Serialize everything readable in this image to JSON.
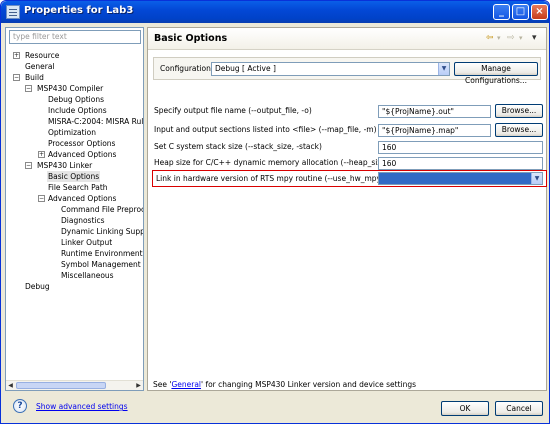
{
  "window": {
    "title": "Properties for Lab3",
    "min": "_",
    "max": "□",
    "close": "×"
  },
  "filter": {
    "placeholder": "type filter text"
  },
  "tree": [
    {
      "label": "Resource",
      "expander": "+"
    },
    {
      "label": "General"
    },
    {
      "label": "Build",
      "expander": "−"
    },
    {
      "label": "MSP430 Compiler",
      "expander": "−"
    },
    {
      "label": "Debug Options"
    },
    {
      "label": "Include Options"
    },
    {
      "label": "MISRA-C:2004: MISRA Rules"
    },
    {
      "label": "Optimization"
    },
    {
      "label": "Processor Options"
    },
    {
      "label": "Advanced Options",
      "expander": "+"
    },
    {
      "label": "MSP430 Linker",
      "expander": "−"
    },
    {
      "label": "Basic Options"
    },
    {
      "label": "File Search Path"
    },
    {
      "label": "Advanced Options",
      "expander": "−"
    },
    {
      "label": "Command File Preprocess"
    },
    {
      "label": "Diagnostics"
    },
    {
      "label": "Dynamic Linking Support"
    },
    {
      "label": "Linker Output"
    },
    {
      "label": "Runtime Environment"
    },
    {
      "label": "Symbol Management"
    },
    {
      "label": "Miscellaneous"
    },
    {
      "label": "Debug"
    }
  ],
  "page": {
    "title": "Basic Options",
    "nav_back": "⇦",
    "nav_fwd": "⇨",
    "menu": "▾"
  },
  "config": {
    "label": "Configuration:",
    "value": "Debug  [ Active ]",
    "manage": "Manage Configurations..."
  },
  "options": [
    {
      "label": "Specify output file name (--output_file, -o)",
      "value": "\"${ProjName}.out\"",
      "button": "Browse..."
    },
    {
      "label": "Input and output sections listed into <file> (--map_file, -m)",
      "value": "\"${ProjName}.map\"",
      "button": "Browse..."
    },
    {
      "label": "Set C system stack size (--stack_size, -stack)",
      "value": "160"
    },
    {
      "label": "Heap size for C/C++ dynamic memory allocation (--heap_size, -heap)",
      "value": "160"
    },
    {
      "label": "Link in hardware version of RTS mpy routine (--use_hw_mpy)",
      "value": ""
    }
  ],
  "note": {
    "prefix": "See '",
    "link": "General",
    "suffix": "' for changing MSP430 Linker version and device settings"
  },
  "bottom": {
    "help": "?",
    "advanced": "Show advanced settings",
    "ok": "OK",
    "cancel": "Cancel"
  },
  "colors": {
    "title_bar": "#0a5fe8",
    "highlight": "#d90000",
    "selected_value": "#316ac5"
  }
}
